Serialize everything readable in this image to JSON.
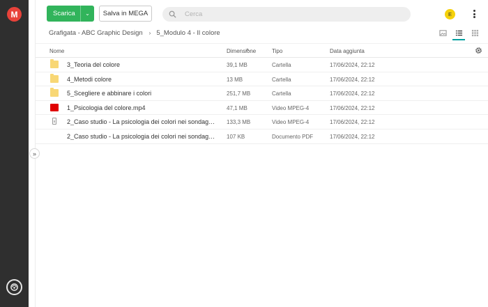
{
  "app": {
    "logo_letter": "M"
  },
  "toolbar": {
    "download_label": "Scarica",
    "download_menu_glyph": "⌄",
    "save_label": "Salva in MEGA",
    "search_placeholder": "Cerca",
    "avatar_initial": "E"
  },
  "breadcrumb": {
    "items": [
      "Grafigata - ABC Graphic Design",
      "5_Modulo 4 - Il colore"
    ],
    "separator": "›"
  },
  "table": {
    "columns": {
      "name": "Nome",
      "size": "Dimensione",
      "type": "Tipo",
      "date": "Data aggiunta"
    },
    "sort_glyph": "^",
    "rows": [
      {
        "icon": "folder-icon",
        "name": "3_Teoria del colore",
        "size": "39,1 MB",
        "type": "Cartella",
        "date": "17/06/2024, 22:12"
      },
      {
        "icon": "folder-icon",
        "name": "4_Metodi colore",
        "size": "13 MB",
        "type": "Cartella",
        "date": "17/06/2024, 22:12"
      },
      {
        "icon": "folder-icon",
        "name": "5_Scegliere e abbinare i colori",
        "size": "251,7 MB",
        "type": "Cartella",
        "date": "17/06/2024, 22:12"
      },
      {
        "icon": "video-file-icon",
        "name": "1_Psicologia del colore.mp4",
        "size": "47,1 MB",
        "type": "Video MPEG-4",
        "date": "17/06/2024, 22:12"
      },
      {
        "icon": "generic-file-icon",
        "name": "2_Caso studio - La psicologia dei colori nei sondaggi ...",
        "size": "133,3 MB",
        "type": "Video MPEG-4",
        "date": "17/06/2024, 22:12"
      },
      {
        "icon": "none",
        "name": "2_Caso studio - La psicologia dei colori nei sondaggi ...",
        "size": "107 KB",
        "type": "Documento PDF",
        "date": "17/06/2024, 22:12"
      }
    ]
  },
  "sidebar": {
    "expand_glyph": "»"
  },
  "colors": {
    "accent_green": "#31b45b",
    "brand_red": "#e8423a",
    "rail": "#2f2f2f",
    "view_active": "#00a0a0"
  }
}
